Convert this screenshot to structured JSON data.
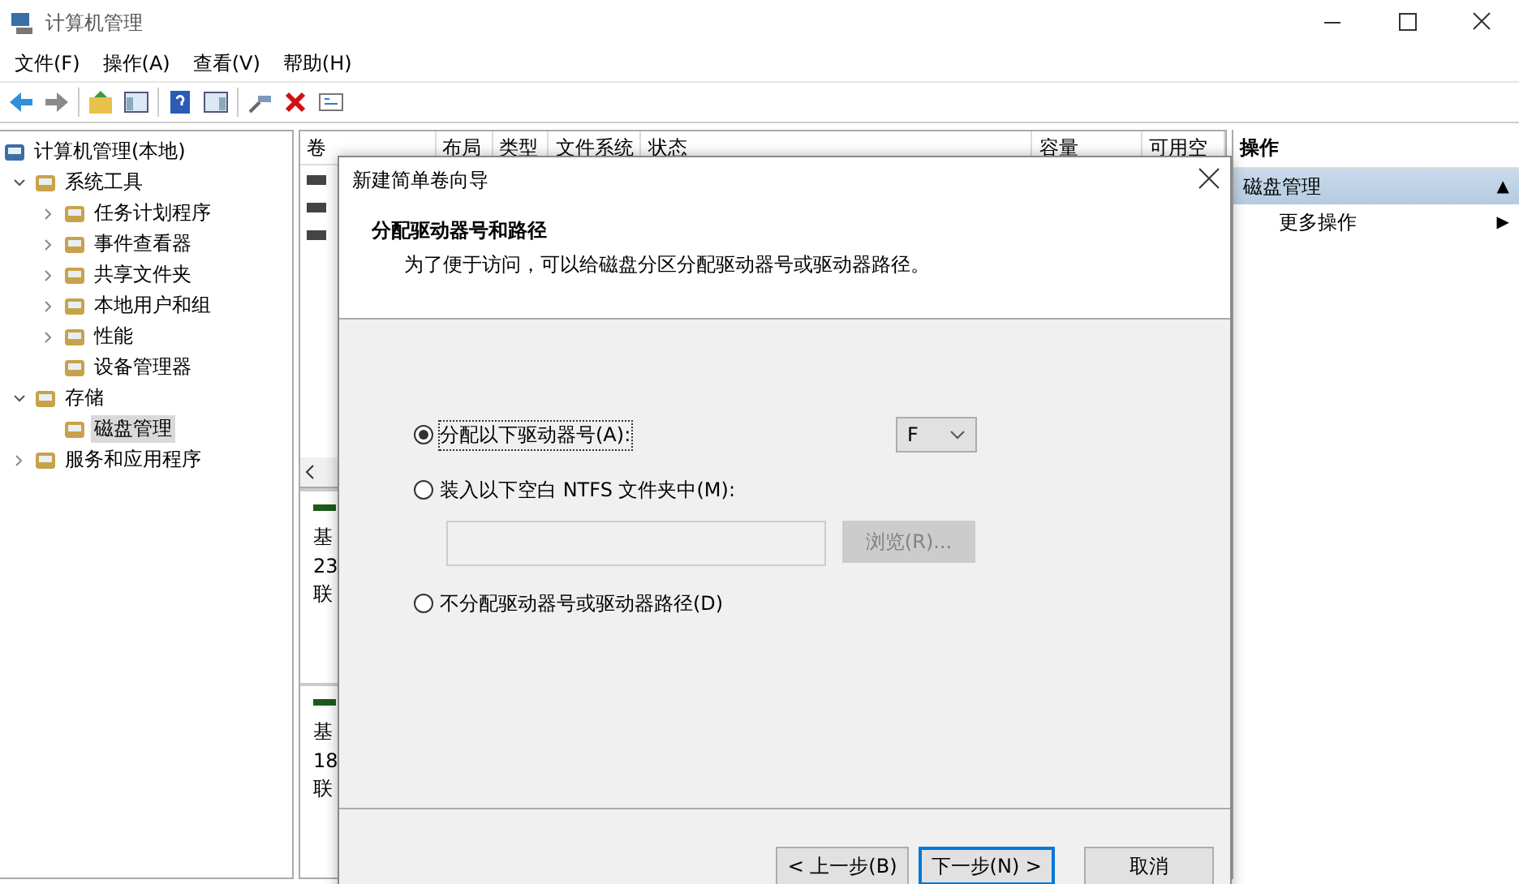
{
  "window": {
    "title": "计算机管理"
  },
  "menu": [
    "文件(F)",
    "操作(A)",
    "查看(V)",
    "帮助(H)"
  ],
  "tree": [
    {
      "label": "计算机管理(本地)",
      "selected": false,
      "children": [
        {
          "label": "系统工具",
          "expanded": true,
          "selected": false,
          "children": [
            {
              "label": "任务计划程序",
              "expanded": false,
              "selected": false
            },
            {
              "label": "事件查看器",
              "expanded": false,
              "selected": false
            },
            {
              "label": "共享文件夹",
              "expanded": false,
              "selected": false
            },
            {
              "label": "本地用户和组",
              "expanded": false,
              "selected": false
            },
            {
              "label": "性能",
              "expanded": false,
              "selected": false
            },
            {
              "label": "设备管理器",
              "selected": false
            }
          ]
        },
        {
          "label": "存储",
          "expanded": true,
          "selected": false,
          "children": [
            {
              "label": "磁盘管理",
              "selected": true
            }
          ]
        },
        {
          "label": "服务和应用程序",
          "expanded": false,
          "selected": false
        }
      ]
    }
  ],
  "table": {
    "columns": [
      "卷",
      "布局",
      "类型",
      "文件系统",
      "状态",
      "容量",
      "可用空"
    ]
  },
  "disk_pane": {
    "disks": [
      {
        "lines": [
          "基",
          "23",
          "联"
        ]
      },
      {
        "lines": [
          "基",
          "18",
          "联"
        ]
      }
    ]
  },
  "actions": {
    "title": "操作",
    "items": [
      {
        "label": "磁盘管理",
        "arrow": "▲",
        "kind": "header"
      },
      {
        "label": "更多操作",
        "arrow": "▶",
        "kind": "item"
      }
    ]
  },
  "dialog": {
    "title": "新建简单卷向导",
    "heading": "分配驱动器号和路径",
    "subtitle": "为了便于访问，可以给磁盘分区分配驱动器号或驱动器路径。",
    "options": [
      {
        "label": "分配以下驱动器号(A):",
        "selected": true,
        "kind": "letter",
        "value": "F"
      },
      {
        "label": "装入以下空白 NTFS 文件夹中(M):",
        "selected": false,
        "kind": "folder",
        "browse": "浏览(R)...",
        "disabled": true
      },
      {
        "label": "不分配驱动器号或驱动器路径(D)",
        "selected": false,
        "kind": "none"
      }
    ],
    "buttons": [
      {
        "label": "< 上一步(B)",
        "default": false
      },
      {
        "label": "下一步(N) >",
        "default": true
      },
      {
        "label": "取消",
        "default": false
      }
    ]
  }
}
